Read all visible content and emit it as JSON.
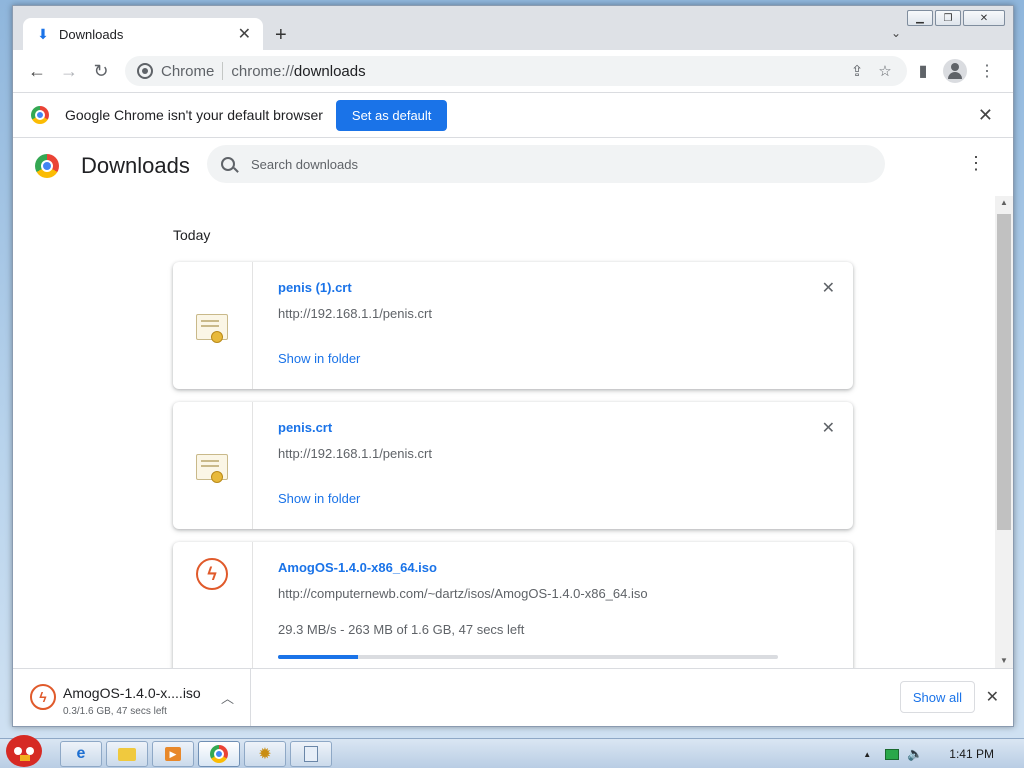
{
  "window": {
    "minimize_icon": "minimize-icon",
    "maximize_icon": "restore-icon",
    "close_icon": "close-icon"
  },
  "tab": {
    "title": "Downloads",
    "close": "✕",
    "new_tab": "+",
    "search_tabs": "⌄"
  },
  "toolbar": {
    "back": "←",
    "forward": "→",
    "reload": "↻",
    "site_label": "Chrome",
    "url_scheme": "chrome://",
    "url_host": "downloads",
    "share": "⇪",
    "bookmark": "☆",
    "side_panel": "▮",
    "menu": "⋮"
  },
  "infobar": {
    "text": "Google Chrome isn't your default browser",
    "button": "Set as default",
    "close": "✕"
  },
  "page": {
    "title": "Downloads",
    "search_placeholder": "Search downloads",
    "menu": "⋮",
    "section": "Today"
  },
  "downloads": [
    {
      "name": "penis (1).crt",
      "url": "http://192.168.1.1/penis.crt",
      "action": "Show in folder",
      "close": "✕"
    },
    {
      "name": "penis.crt",
      "url": "http://192.168.1.1/penis.crt",
      "action": "Show in folder",
      "close": "✕"
    },
    {
      "name": "AmogOS-1.4.0-x86_64.iso",
      "url": "http://computernewb.com/~dartz/isos/AmogOS-1.4.0-x86_64.iso",
      "status": "29.3 MB/s - 263 MB of 1.6 GB, 47 secs left",
      "progress": 0.16
    }
  ],
  "shelf": {
    "name": "AmogOS-1.4.0-x....iso",
    "status": "0.3/1.6 GB, 47 secs left",
    "show_all": "Show all",
    "close": "✕"
  },
  "taskbar": {
    "clock": "1:41 PM"
  }
}
